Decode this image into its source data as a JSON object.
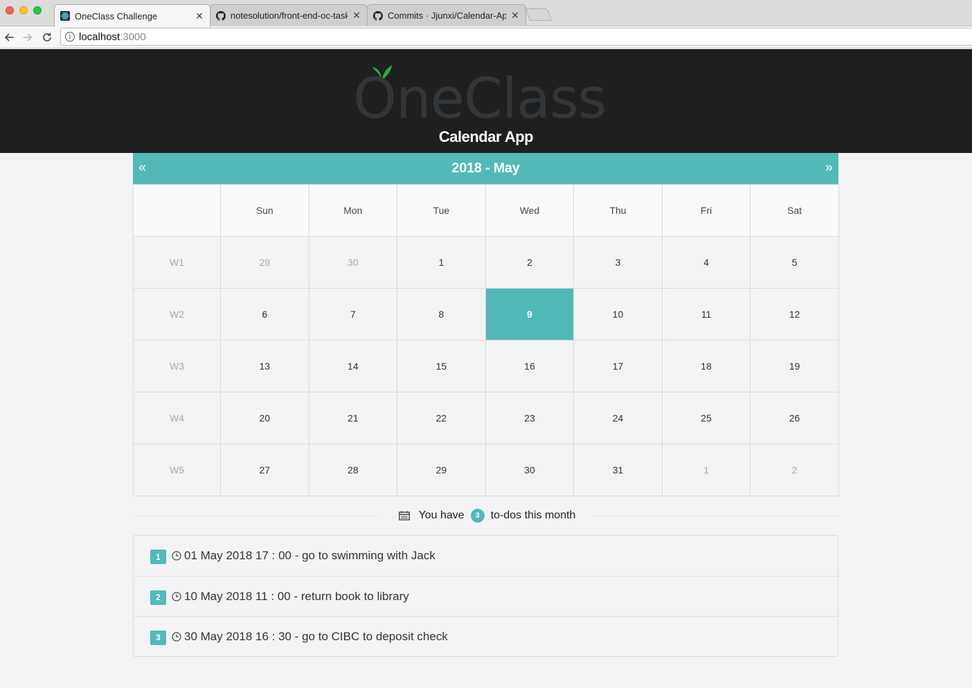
{
  "browser": {
    "tabs": [
      {
        "title": "OneClass Challenge",
        "favicon": "react-icon",
        "active": true
      },
      {
        "title": "notesolution/front-end-oc-task",
        "favicon": "github-icon",
        "active": false
      },
      {
        "title": "Commits · Jjunxi/Calendar-App",
        "favicon": "github-icon",
        "active": false
      }
    ],
    "url_host": "localhost",
    "url_port": ":3000"
  },
  "header": {
    "logo_text": "OneClass",
    "title": "Calendar App"
  },
  "calendar": {
    "month_title": "2018 - May",
    "prev_icon": "«",
    "next_icon": "»",
    "weekdays": [
      "Sun",
      "Mon",
      "Tue",
      "Wed",
      "Thu",
      "Fri",
      "Sat"
    ],
    "weeks": [
      {
        "label": "W1",
        "days": [
          {
            "d": "29",
            "muted": true
          },
          {
            "d": "30",
            "muted": true
          },
          {
            "d": "1"
          },
          {
            "d": "2"
          },
          {
            "d": "3"
          },
          {
            "d": "4"
          },
          {
            "d": "5"
          }
        ]
      },
      {
        "label": "W2",
        "days": [
          {
            "d": "6"
          },
          {
            "d": "7"
          },
          {
            "d": "8"
          },
          {
            "d": "9",
            "today": true
          },
          {
            "d": "10"
          },
          {
            "d": "11"
          },
          {
            "d": "12"
          }
        ]
      },
      {
        "label": "W3",
        "days": [
          {
            "d": "13"
          },
          {
            "d": "14"
          },
          {
            "d": "15"
          },
          {
            "d": "16"
          },
          {
            "d": "17"
          },
          {
            "d": "18"
          },
          {
            "d": "19"
          }
        ]
      },
      {
        "label": "W4",
        "days": [
          {
            "d": "20"
          },
          {
            "d": "21"
          },
          {
            "d": "22"
          },
          {
            "d": "23"
          },
          {
            "d": "24"
          },
          {
            "d": "25"
          },
          {
            "d": "26"
          }
        ]
      },
      {
        "label": "W5",
        "days": [
          {
            "d": "27"
          },
          {
            "d": "28"
          },
          {
            "d": "29"
          },
          {
            "d": "30"
          },
          {
            "d": "31"
          },
          {
            "d": "1",
            "muted": true
          },
          {
            "d": "2",
            "muted": true
          }
        ]
      }
    ]
  },
  "todos": {
    "summary_prefix": "You have",
    "count": "3",
    "summary_suffix": "to-dos this month",
    "items": [
      {
        "num": "1",
        "text": "01 May 2018 17 : 00 - go to swimming with Jack"
      },
      {
        "num": "2",
        "text": "10 May 2018 11 : 00 - return book to library"
      },
      {
        "num": "3",
        "text": "30 May 2018 16 : 30 - go to CIBC to deposit check"
      }
    ]
  },
  "colors": {
    "accent": "#51bab7",
    "header_bg": "#1f1f1f",
    "leaf_green": "#2ea84a"
  }
}
